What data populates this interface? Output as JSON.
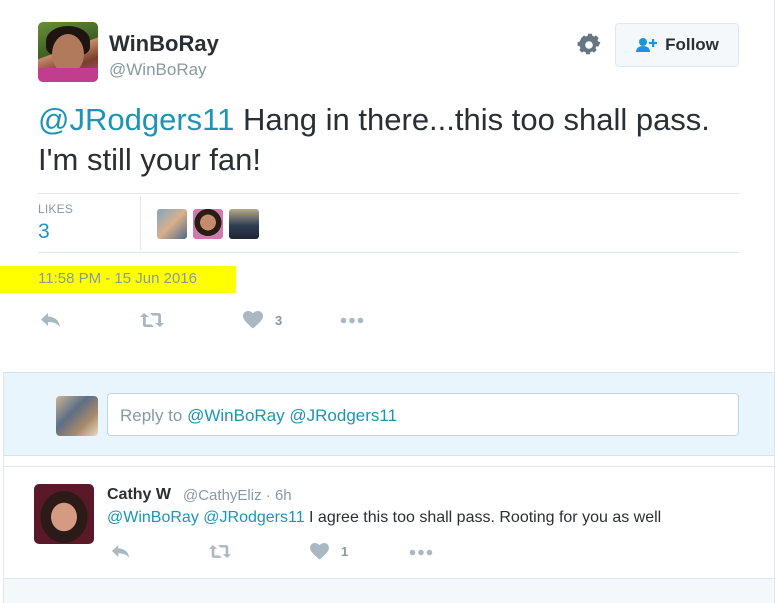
{
  "tweet": {
    "author": {
      "name": "WinBoRay",
      "handle": "@WinBoRay"
    },
    "follow_label": "Follow",
    "text_mention": "@JRodgers11",
    "text_body": " Hang in there...this too shall pass. I'm still your fan!",
    "likes_label": "LIKES",
    "likes_count": "3",
    "timestamp": "11:58 PM - 15 Jun 2016",
    "actions": {
      "like_count": "3"
    },
    "highlight_color": "#ffff00"
  },
  "reply_box": {
    "prefix": "Reply to ",
    "mentions": "@WinBoRay @JRodgers11"
  },
  "reply": {
    "name": "Cathy W",
    "handle": "@CathyEliz",
    "separator": " · ",
    "time": "6h",
    "mentions": "@WinBoRay @JRodgers11",
    "text": " I agree this too shall pass. Rooting for you as well",
    "like_count": "1"
  },
  "colors": {
    "accent": "#1b95b5",
    "muted": "#8899a6",
    "text": "#292f33",
    "reply_bg": "#e8f5fd"
  },
  "icons": [
    "gear-icon",
    "follow-user-icon",
    "reply-icon",
    "retweet-icon",
    "heart-icon",
    "more-icon"
  ]
}
